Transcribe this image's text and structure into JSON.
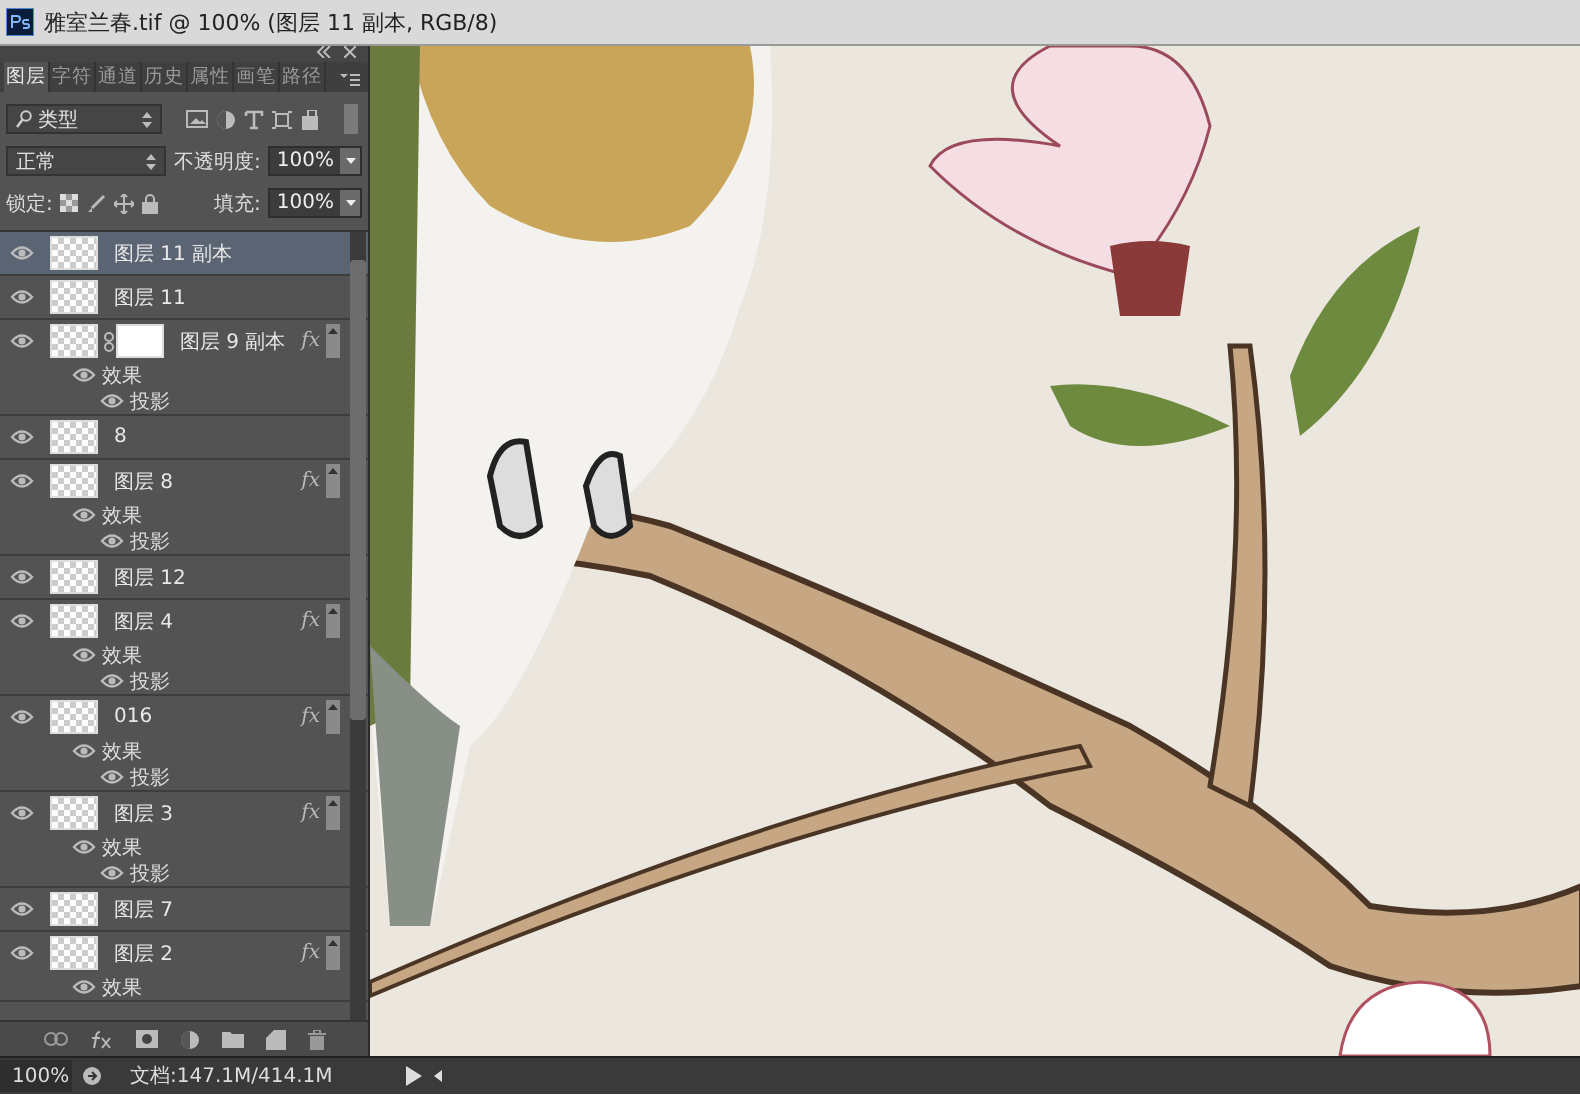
{
  "window": {
    "title": "雅室兰春.tif @ 100% (图层 11 副本, RGB/8)"
  },
  "panel": {
    "tabs": [
      {
        "label": "图层",
        "selected": true
      },
      {
        "label": "字符",
        "selected": false
      },
      {
        "label": "通道",
        "selected": false
      },
      {
        "label": "历史",
        "selected": false
      },
      {
        "label": "属性",
        "selected": false
      },
      {
        "label": "画笔",
        "selected": false
      },
      {
        "label": "路径",
        "selected": false
      }
    ],
    "filter": {
      "value": "类型"
    },
    "blend_mode": {
      "value": "正常"
    },
    "opacity": {
      "label": "不透明度:",
      "value": "100%"
    },
    "lock": {
      "label": "锁定:"
    },
    "fill": {
      "label": "填充:",
      "value": "100%"
    },
    "layers": [
      {
        "name": "图层 11 副本",
        "selected": true,
        "visible": true
      },
      {
        "name": "图层 11",
        "selected": false,
        "visible": true
      },
      {
        "name": "图层 9 副本",
        "selected": false,
        "visible": true,
        "has_mask": true,
        "fx": "fx",
        "effects": {
          "label": "效果",
          "children": [
            "投影"
          ]
        }
      },
      {
        "name": "8",
        "selected": false,
        "visible": true
      },
      {
        "name": "图层 8",
        "selected": false,
        "visible": true,
        "fx": "fx",
        "effects": {
          "label": "效果",
          "children": [
            "投影"
          ]
        }
      },
      {
        "name": "图层 12",
        "selected": false,
        "visible": true
      },
      {
        "name": "图层 4",
        "selected": false,
        "visible": true,
        "fx": "fx",
        "effects": {
          "label": "效果",
          "children": [
            "投影"
          ]
        }
      },
      {
        "name": "016",
        "selected": false,
        "visible": true,
        "fx": "fx",
        "effects": {
          "label": "效果",
          "children": [
            "投影"
          ]
        }
      },
      {
        "name": "图层 3",
        "selected": false,
        "visible": true,
        "fx": "fx",
        "effects": {
          "label": "效果",
          "children": [
            "投影"
          ]
        }
      },
      {
        "name": "图层 7",
        "selected": false,
        "visible": true
      },
      {
        "name": "图层 2",
        "selected": false,
        "visible": true,
        "fx": "fx",
        "effects": {
          "label": "效果"
        }
      }
    ]
  },
  "status_bar": {
    "zoom": "100%",
    "doc_info": "文档:147.1M/414.1M"
  }
}
